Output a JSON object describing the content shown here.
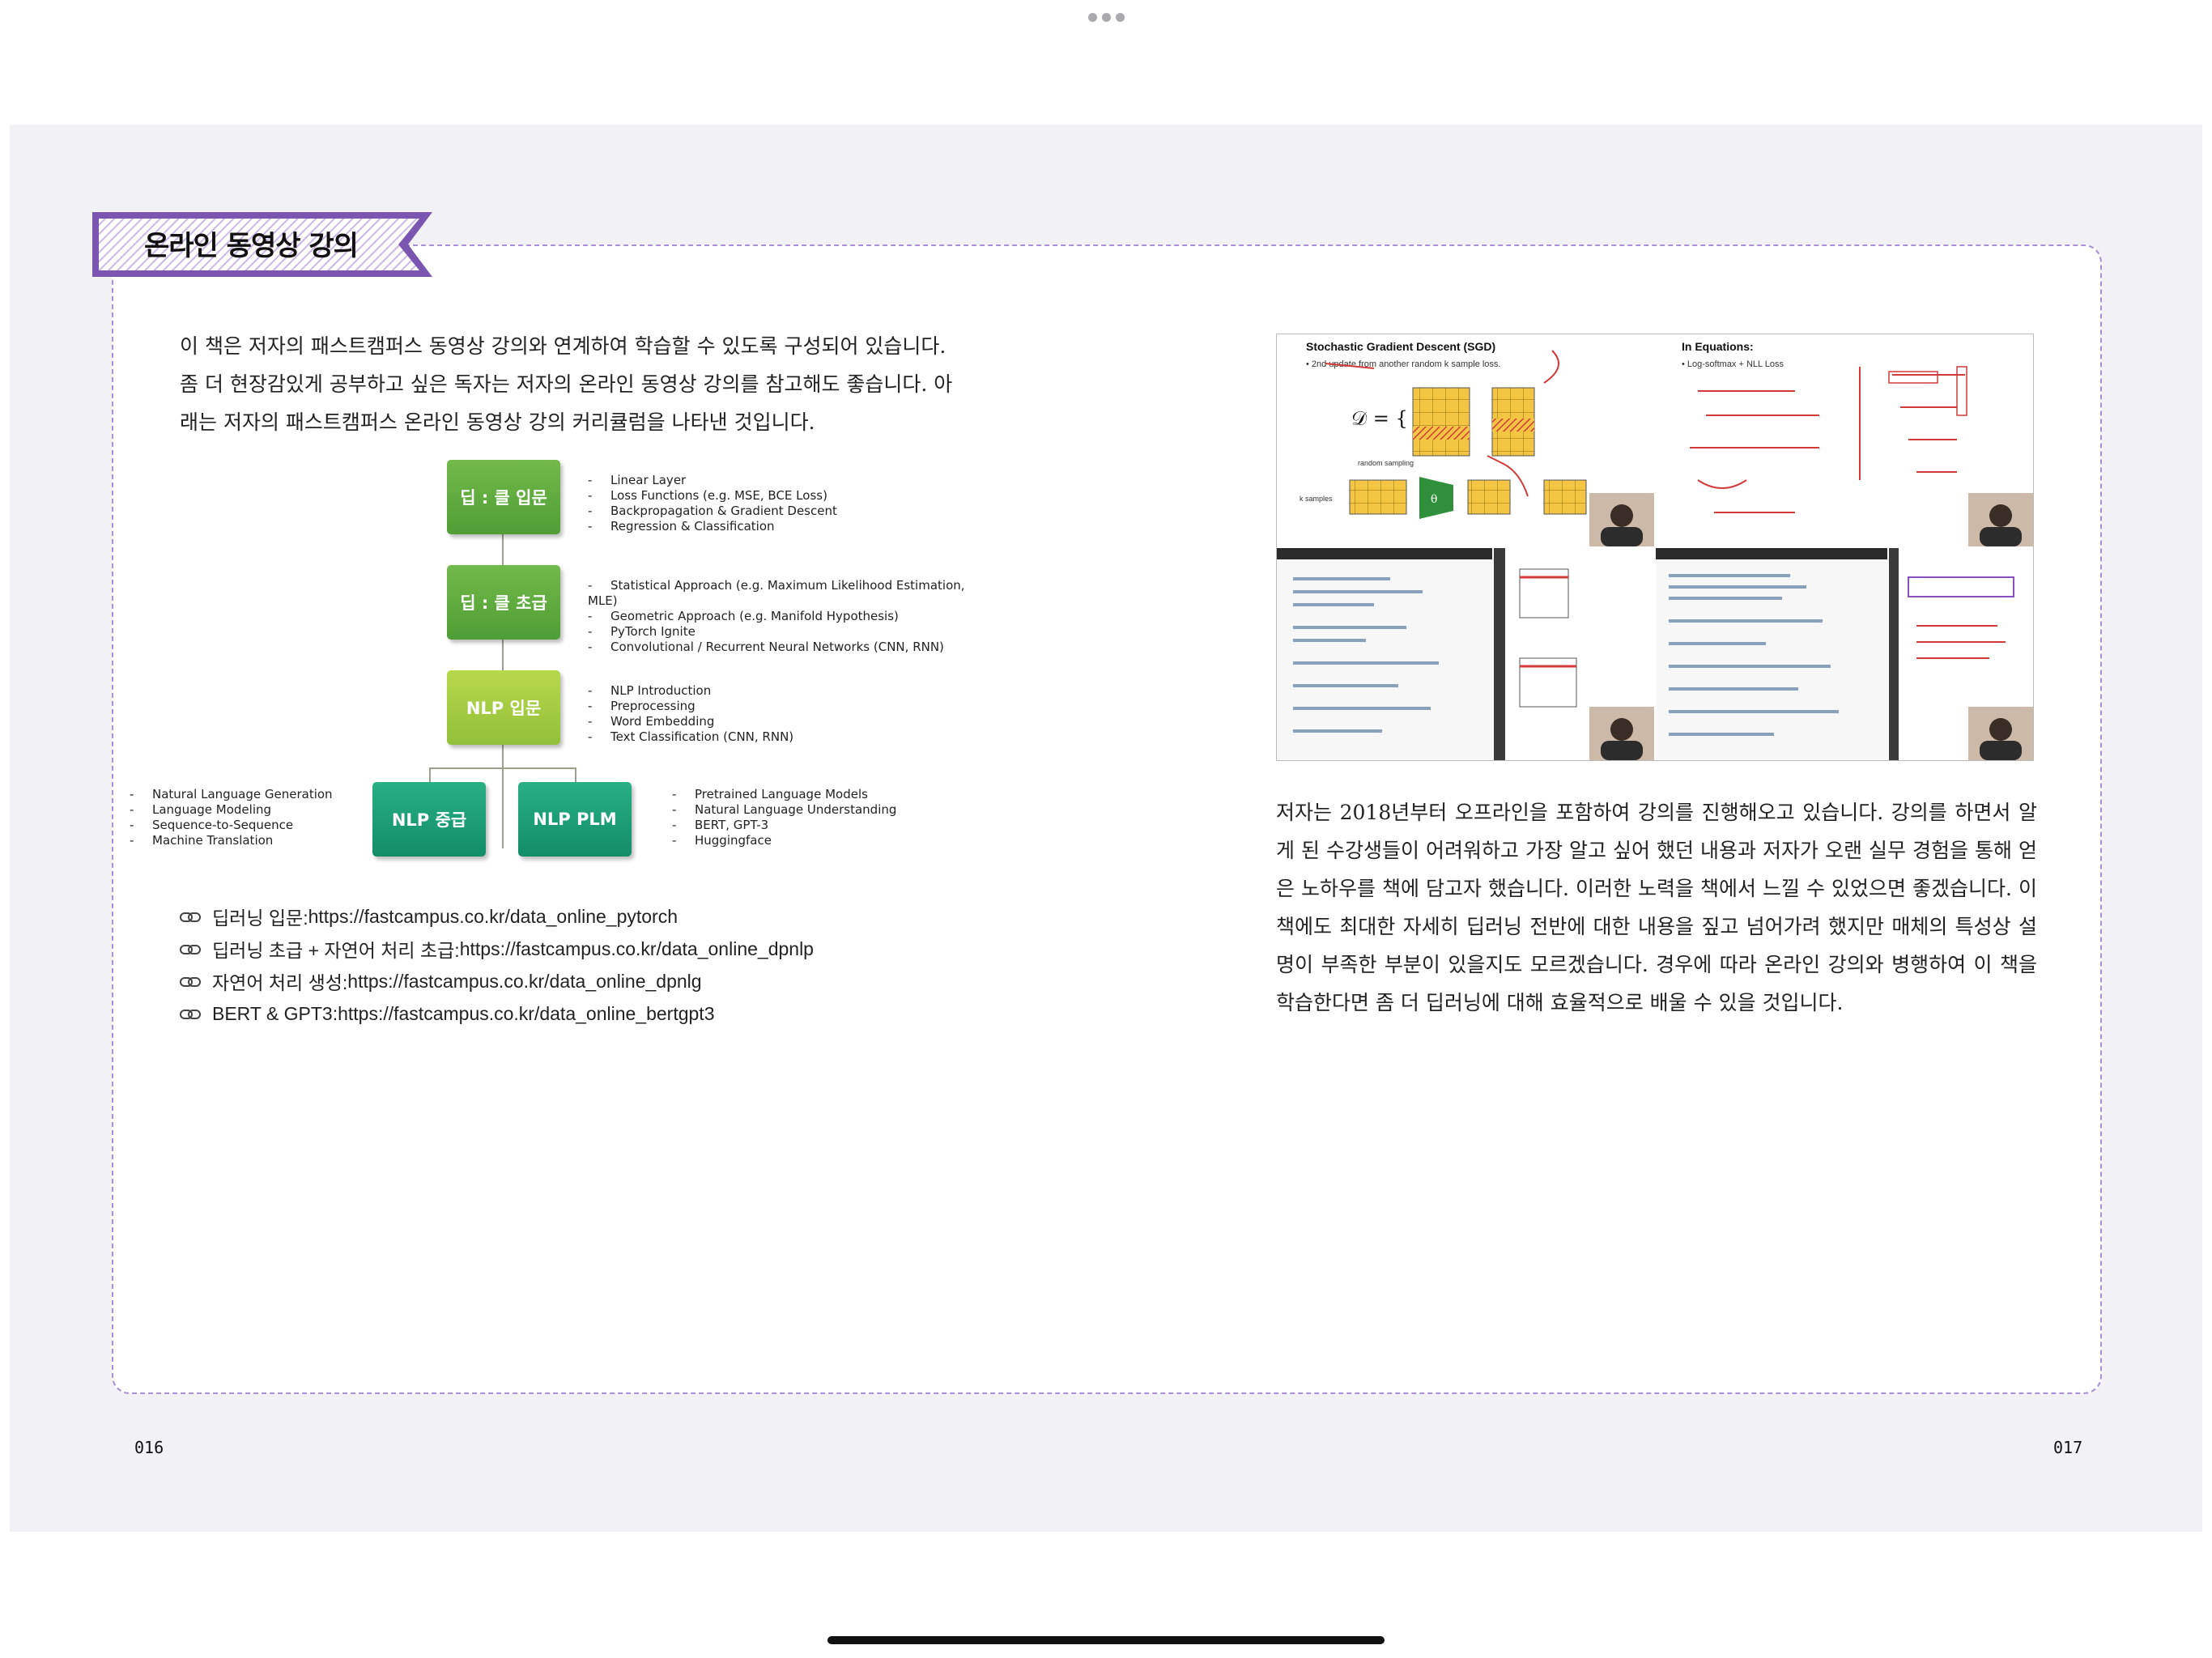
{
  "section_tag": "온라인 동영상 강의",
  "left_paragraph": "이 책은 저자의 패스트캠퍼스 동영상 강의와 연계하여 학습할 수 있도록 구성되어 있습니다. 좀 더 현장감있게 공부하고 싶은 독자는 저자의 온라인 동영상 강의를 참고해도 좋습니다. 아래는 저자의 패스트캠퍼스 온라인 동영상 강의 커리큘럼을 나타낸 것입니다.",
  "curriculum": {
    "nodes": [
      {
        "label": "딥 : 클 입문",
        "items": [
          "Linear Layer",
          "Loss Functions (e.g. MSE, BCE Loss)",
          "Backpropagation & Gradient Descent",
          "Regression & Classification"
        ]
      },
      {
        "label": "딥 : 클 초급",
        "items": [
          "Statistical Approach (e.g. Maximum Likelihood Estimation, MLE)",
          "Geometric Approach (e.g. Manifold Hypothesis)",
          "PyTorch Ignite",
          "Convolutional / Recurrent Neural Networks (CNN, RNN)"
        ]
      },
      {
        "label": "NLP 입문",
        "items": [
          "NLP Introduction",
          "Preprocessing",
          "Word Embedding",
          "Text Classification (CNN, RNN)"
        ]
      },
      {
        "label": "NLP 중급",
        "items": [
          "Natural Language Generation",
          "Language Modeling",
          "Sequence-to-Sequence",
          "Machine Translation"
        ]
      },
      {
        "label": "NLP PLM",
        "items": [
          "Pretrained Language Models",
          "Natural Language Understanding",
          "BERT, GPT-3",
          "Huggingface"
        ]
      }
    ]
  },
  "links": [
    {
      "label": "딥러닝 입문: ",
      "url": "https://fastcampus.co.kr/data_online_pytorch"
    },
    {
      "label": "딥러닝 초급 + 자연어 처리 초급: ",
      "url": "https://fastcampus.co.kr/data_online_dpnlp"
    },
    {
      "label": "자연어 처리 생성: ",
      "url": "https://fastcampus.co.kr/data_online_dpnlg"
    },
    {
      "label": "BERT & GPT3: ",
      "url": "https://fastcampus.co.kr/data_online_bertgpt3"
    }
  ],
  "lecture_screens": {
    "sgd_title": "Stochastic Gradient Descent (SGD)",
    "sgd_note": "• 2nd update from another random k sample loss.",
    "eq_title": "In Equations:",
    "eq_note": "• Log-softmax + NLL Loss",
    "dataset_symbol": "𝒟 = {",
    "theta_symbol": "θ",
    "random_sampling": "random sampling",
    "k_samples": "k samples"
  },
  "right_paragraph": "저자는 2018년부터 오프라인을 포함하여 강의를 진행해오고 있습니다. 강의를 하면서 알게 된 수강생들이 어려워하고 가장 알고 싶어 했던 내용과 저자가 오랜 실무 경험을 통해 얻은 노하우를 책에 담고자 했습니다. 이러한 노력을 책에서 느낄 수 있었으면 좋겠습니다. 이 책에도 최대한 자세히 딥러닝 전반에 대한 내용을 짚고 넘어가려 했지만 매체의 특성상 설명이 부족한 부분이 있을지도 모르겠습니다. 경우에 따라 온라인 강의와 병행하여 이 책을 학습한다면 좀 더 딥러닝에 대해 효율적으로 배울 수 있을 것입니다.",
  "page_left": "016",
  "page_right": "017",
  "colors": {
    "tag_purple": "#7a56b0",
    "frame_dash": "#a98fd3",
    "green": "#5aa63c",
    "lime": "#a4cc42",
    "teal": "#1a9d75"
  }
}
